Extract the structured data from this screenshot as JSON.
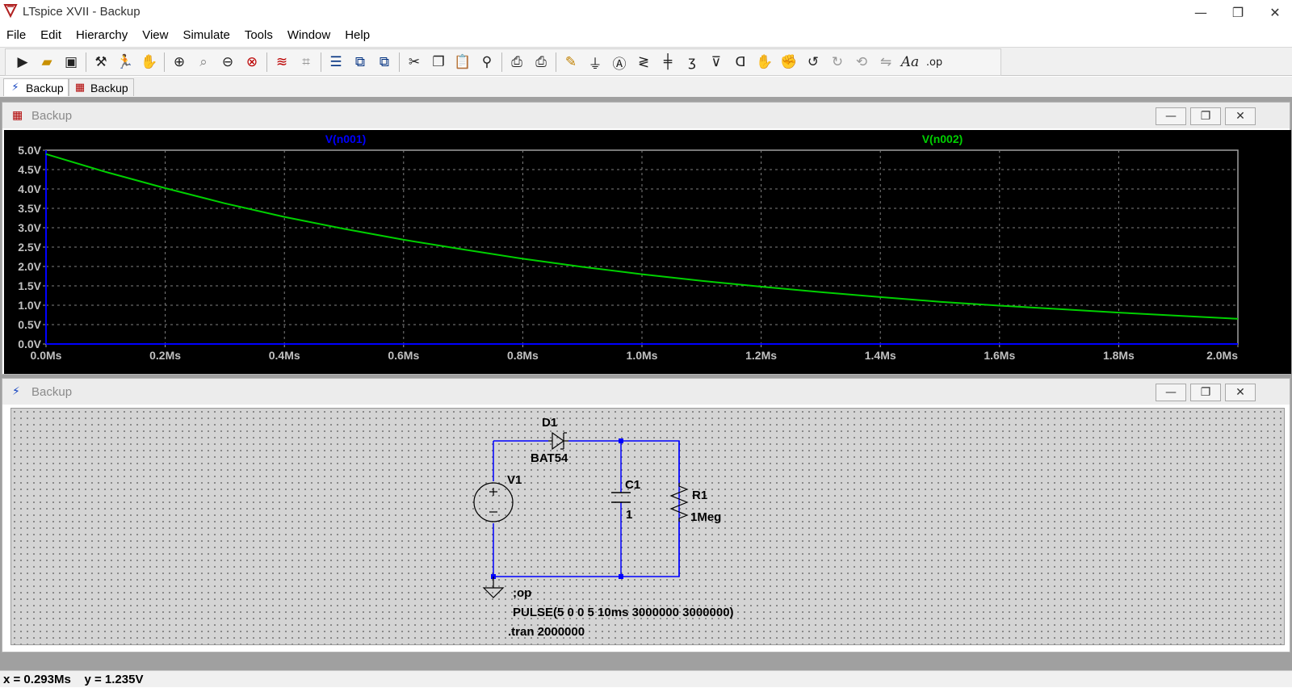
{
  "window": {
    "title": "LTspice XVII - Backup",
    "minimize_glyph": "—",
    "restore_glyph": "❐",
    "close_glyph": "✕"
  },
  "menu": [
    "File",
    "Edit",
    "Hierarchy",
    "View",
    "Simulate",
    "Tools",
    "Window",
    "Help"
  ],
  "toolbar": {
    "icons": [
      "open-schematic-icon",
      "open-folder-icon",
      "save-icon",
      "control-panel-icon",
      "run-icon",
      "pan-hand-icon",
      "zoom-in-icon",
      "zoom-to-fit-icon",
      "zoom-out-icon",
      "zoom-cancel-icon",
      "autorange-icon",
      "waveform-icon",
      "tile-horizontal-icon",
      "cascade-icon",
      "tile-vertical-icon",
      "cut-icon",
      "copy-icon",
      "paste-icon",
      "find-icon",
      "print-icon",
      "print-preview-icon",
      "draw-wire-icon",
      "ground-icon",
      "label-net-icon",
      "resistor-icon",
      "capacitor-icon",
      "inductor-icon",
      "diode-icon",
      "component-icon",
      "move-icon",
      "drag-icon",
      "undo-icon",
      "redo-icon",
      "rotate-icon",
      "mirror-icon",
      "text-icon",
      "spice-directive-icon"
    ]
  },
  "tabs": [
    {
      "label": "Backup",
      "icon": "schematic-icon",
      "active": true
    },
    {
      "label": "Backup",
      "icon": "waveform-icon",
      "active": false
    }
  ],
  "plot_window": {
    "title": "Backup",
    "min": "—",
    "max": "❐",
    "close": "✕"
  },
  "schematic_window": {
    "title": "Backup",
    "min": "—",
    "max": "❐",
    "close": "✕"
  },
  "chart_data": {
    "type": "line",
    "xlim": [
      0,
      2.0
    ],
    "ylim": [
      0,
      5.0
    ],
    "xticks": [
      "0.0Ms",
      "0.2Ms",
      "0.4Ms",
      "0.6Ms",
      "0.8Ms",
      "1.0Ms",
      "1.2Ms",
      "1.4Ms",
      "1.6Ms",
      "1.8Ms",
      "2.0Ms"
    ],
    "yticks": [
      "0.0V",
      "0.5V",
      "1.0V",
      "1.5V",
      "2.0V",
      "2.5V",
      "3.0V",
      "3.5V",
      "4.0V",
      "4.5V",
      "5.0V"
    ],
    "grid": true,
    "series": [
      {
        "name": "V(n001)",
        "color": "#0000ff",
        "values": []
      },
      {
        "name": "V(n002)",
        "color": "#00d000",
        "x": [
          0.0,
          0.1,
          0.2,
          0.3,
          0.4,
          0.5,
          0.6,
          0.7,
          0.8,
          0.9,
          1.0,
          1.1,
          1.2,
          1.3,
          1.4,
          1.5,
          1.6,
          1.7,
          1.8,
          1.9,
          2.0
        ],
        "values": [
          4.9,
          4.44,
          4.02,
          3.63,
          3.28,
          2.97,
          2.69,
          2.44,
          2.2,
          1.99,
          1.8,
          1.63,
          1.48,
          1.34,
          1.21,
          1.09,
          0.99,
          0.9,
          0.81,
          0.73,
          0.65
        ]
      }
    ]
  },
  "schematic": {
    "components": [
      {
        "ref": "D1",
        "value": "BAT54"
      },
      {
        "ref": "V1",
        "value": ""
      },
      {
        "ref": "C1",
        "value": "1"
      },
      {
        "ref": "R1",
        "value": "1Meg"
      }
    ],
    "directives": [
      ";op",
      "PULSE(5 0 0 5 10ms 3000000 3000000)",
      ".tran 2000000"
    ]
  },
  "status": {
    "text": "x = 0.293Ms    y = 1.235V"
  }
}
